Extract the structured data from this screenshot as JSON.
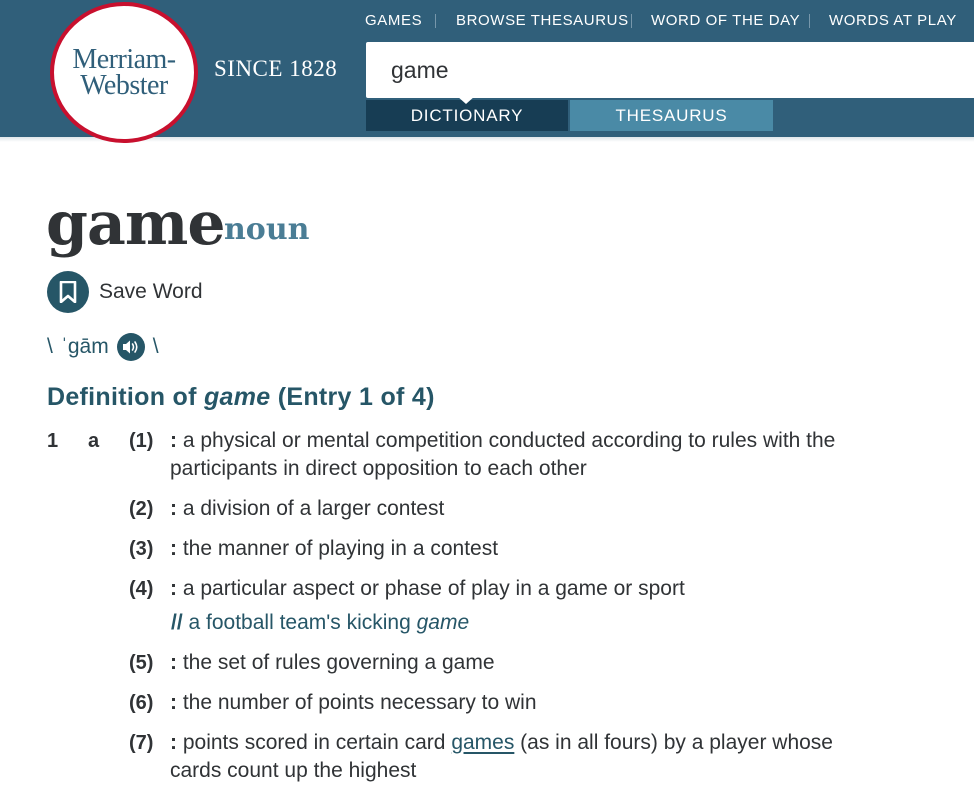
{
  "header": {
    "logo_line1": "Merriam-",
    "logo_line2": "Webster",
    "since": "SINCE 1828",
    "nav": [
      "GAMES",
      "BROWSE THESAURUS",
      "WORD OF THE DAY",
      "WORDS AT PLAY"
    ],
    "search_value": "game",
    "tabs": [
      "DICTIONARY",
      "THESAURUS"
    ],
    "active_tab": "DICTIONARY"
  },
  "entry": {
    "headword": "game",
    "part_of_speech": "noun",
    "save_label": "Save Word",
    "pron_open": "\\",
    "pronunciation": "ˈgām",
    "pron_close": "\\",
    "def_heading_prefix": "Definition of ",
    "def_heading_word": "game",
    "def_heading_suffix": " (Entry 1 of 4)",
    "sense_number": "1",
    "sense_letter": "a",
    "senses": [
      {
        "num": "(1)",
        "text": "a physical or mental competition conducted according to rules with the",
        "text2": "participants in direct opposition to each other"
      },
      {
        "num": "(2)",
        "text": "a division of a larger contest"
      },
      {
        "num": "(3)",
        "text": "the manner of playing in a contest"
      },
      {
        "num": "(4)",
        "text": "a particular aspect or phase of play in a game or sport",
        "example_prefix": "//",
        "example_text": " a football team's kicking ",
        "example_word": "game"
      },
      {
        "num": "(5)",
        "text": "the set of rules governing a game"
      },
      {
        "num": "(6)",
        "text": "the number of points necessary to win"
      },
      {
        "num": "(7)",
        "text_before": "points scored in certain card ",
        "link": "games",
        "text_after": " (as in all fours) by a player whose",
        "text2": "cards count up the highest"
      }
    ]
  },
  "colors": {
    "header_bg": "#305f7a",
    "accent": "#265667",
    "logo_ring": "#c8102e",
    "pos": "#4a7d95"
  }
}
